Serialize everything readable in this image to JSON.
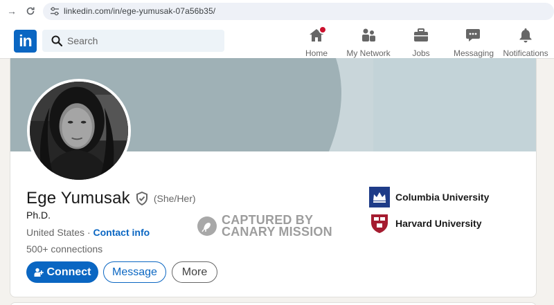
{
  "browser": {
    "url": "linkedin.com/in/ege-yumusak-07a56b35/"
  },
  "nav": {
    "search_placeholder": "Search",
    "items": [
      {
        "label": "Home",
        "icon": "home-icon"
      },
      {
        "label": "My Network",
        "icon": "network-icon"
      },
      {
        "label": "Jobs",
        "icon": "briefcase-icon"
      },
      {
        "label": "Messaging",
        "icon": "messaging-icon"
      },
      {
        "label": "Notifications",
        "icon": "bell-icon"
      }
    ]
  },
  "profile": {
    "name": "Ege Yumusak",
    "pronouns": "(She/Her)",
    "headline": "Ph.D.",
    "location": "United States",
    "separator": " · ",
    "contact_info": "Contact info",
    "connections": "500+ connections",
    "buttons": {
      "connect": "Connect",
      "message": "Message",
      "more": "More"
    },
    "education": [
      {
        "name": "Columbia University"
      },
      {
        "name": "Harvard University"
      }
    ]
  },
  "watermark": {
    "line1": "CAPTURED BY",
    "line2": "CANARY MISSION"
  },
  "colors": {
    "brand": "#0a66c2",
    "notification": "#cb112d"
  }
}
